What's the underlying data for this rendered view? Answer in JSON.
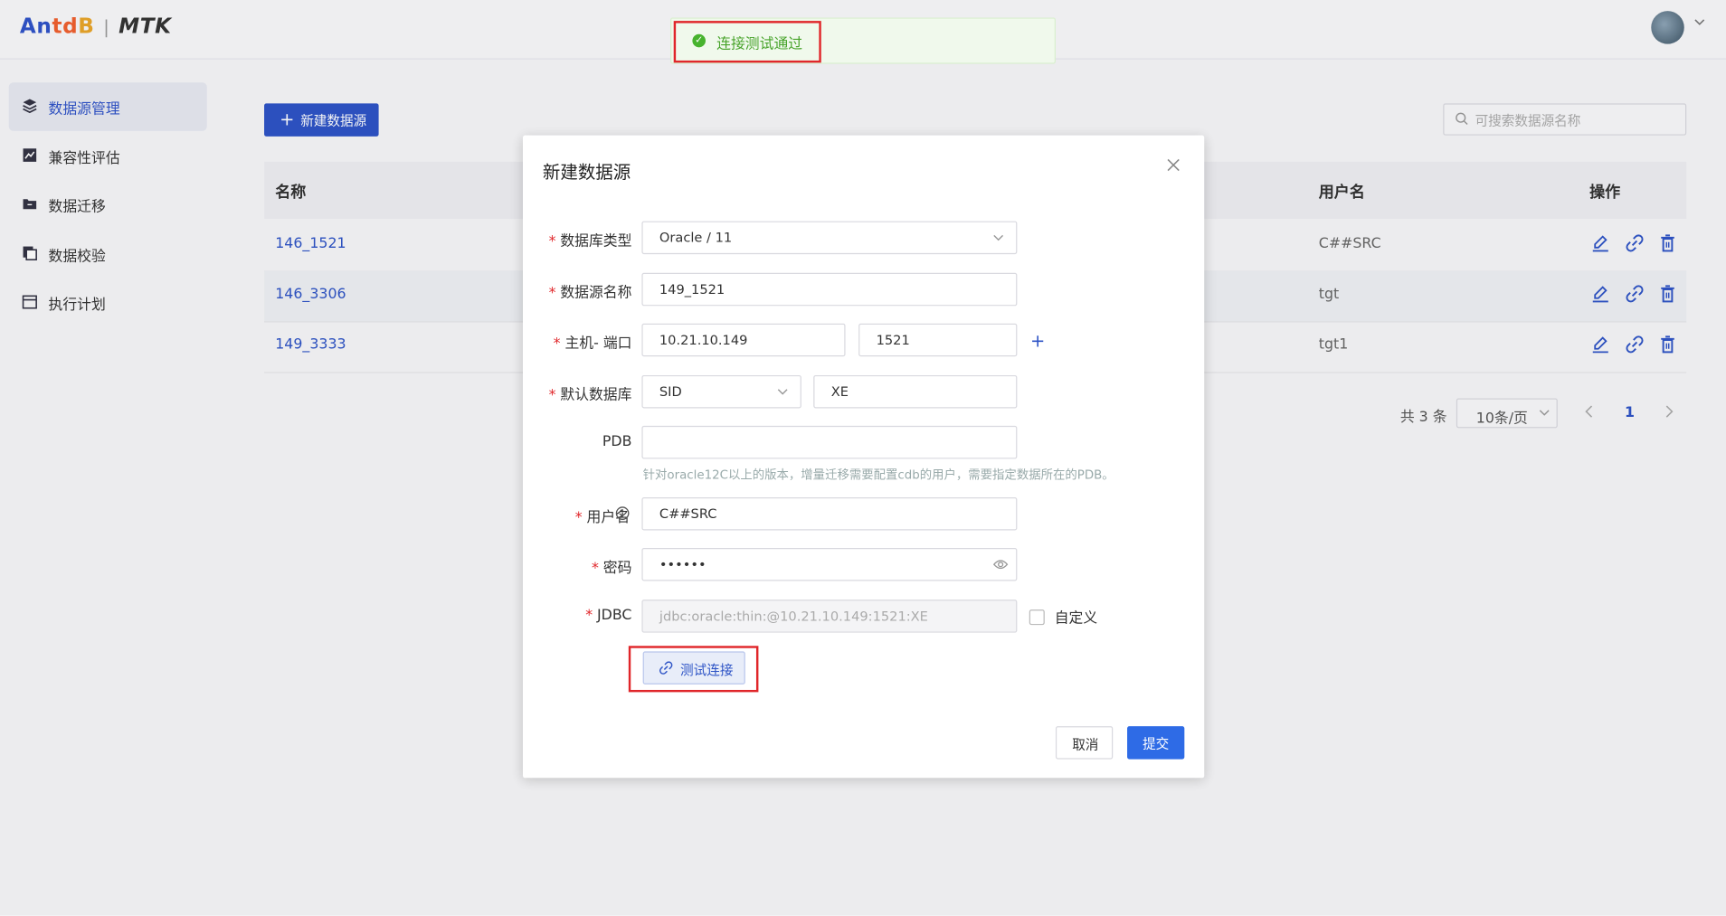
{
  "app": {
    "logo_brand_parts": [
      "An",
      "td",
      "B"
    ],
    "product": "MTK",
    "separator": "|"
  },
  "toast": {
    "message": "连接测试通过",
    "icon": "check-circle-icon"
  },
  "sidebar": {
    "items": [
      {
        "label": "数据源管理",
        "icon": "layers-icon",
        "active": true
      },
      {
        "label": "兼容性评估",
        "icon": "chart-icon",
        "active": false
      },
      {
        "label": "数据迁移",
        "icon": "folder-icon",
        "active": false
      },
      {
        "label": "数据校验",
        "icon": "copy-icon",
        "active": false
      },
      {
        "label": "执行计划",
        "icon": "calendar-icon",
        "active": false
      }
    ]
  },
  "toolbar": {
    "new_label": "新建数据源",
    "search_placeholder": "可搜索数据源名称"
  },
  "table": {
    "headers": {
      "name": "名称",
      "user": "用户名",
      "ops": "操作"
    },
    "rows": [
      {
        "name": "146_1521",
        "user": "C##SRC"
      },
      {
        "name": "146_3306",
        "user": "tgt"
      },
      {
        "name": "149_3333",
        "user": "tgt1"
      }
    ]
  },
  "pagination": {
    "total": "共 3 条",
    "page_size": "10条/页",
    "current": "1"
  },
  "modal": {
    "title": "新建数据源",
    "fields": {
      "db_type": {
        "label": "数据库类型",
        "value": "Oracle / 11",
        "required": true
      },
      "ds_name": {
        "label": "数据源名称",
        "value": "149_1521",
        "required": true
      },
      "host_port": {
        "label": "主机- 端口",
        "host": "10.21.10.149",
        "port": "1521",
        "required": true
      },
      "default_db": {
        "label": "默认数据库",
        "mode": "SID",
        "value": "XE",
        "required": true
      },
      "pdb": {
        "label": "PDB",
        "value": "",
        "hint": "针对oracle12C以上的版本，增量迁移需要配置cdb的用户，需要指定数据所在的PDB。"
      },
      "username": {
        "label": "用户名",
        "value": "C##SRC",
        "required": true
      },
      "password": {
        "label": "密码",
        "value": "••••••",
        "required": true
      },
      "jdbc": {
        "label": "JDBC",
        "value": "jdbc:oracle:thin:@10.21.10.149:1521:XE",
        "required": true,
        "custom_label": "自定义"
      }
    },
    "test_button": "测试连接",
    "cancel": "取消",
    "submit": "提交"
  },
  "colors": {
    "primary": "#2e54c6",
    "success": "#47b32e",
    "highlight": "#e0262a"
  }
}
